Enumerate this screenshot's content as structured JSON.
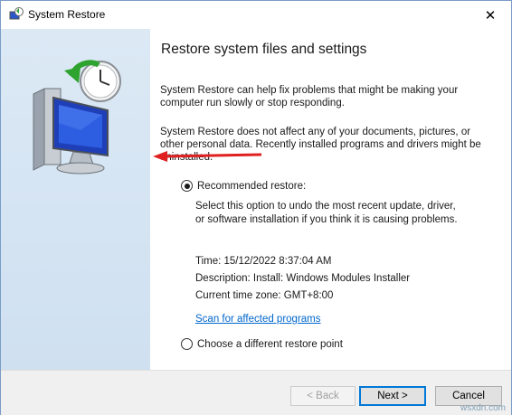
{
  "window": {
    "title": "System Restore"
  },
  "content": {
    "heading": "Restore system files and settings",
    "para1": "System Restore can help fix problems that might be making your computer run slowly or stop responding.",
    "para2": "System Restore does not affect any of your documents, pictures, or other personal data. Recently installed programs and drivers might be uninstalled.",
    "recommended": {
      "label": "Recommended restore:",
      "selected": true,
      "description": "Select this option to undo the most recent update, driver, or software installation if you think it is causing problems.",
      "time": "Time: 15/12/2022 8:37:04 AM",
      "desc": "Description: Install: Windows Modules Installer",
      "timezone": "Current time zone: GMT+8:00",
      "scan_link": "Scan for affected programs"
    },
    "different": {
      "label": "Choose a different restore point",
      "selected": false
    }
  },
  "buttons": {
    "back": "< Back",
    "next": "Next >",
    "cancel": "Cancel"
  },
  "watermark": "wsxdn.com",
  "colors": {
    "arrow": "#e02020",
    "link": "#0066cc",
    "sidebar": "#d4e4f4"
  }
}
